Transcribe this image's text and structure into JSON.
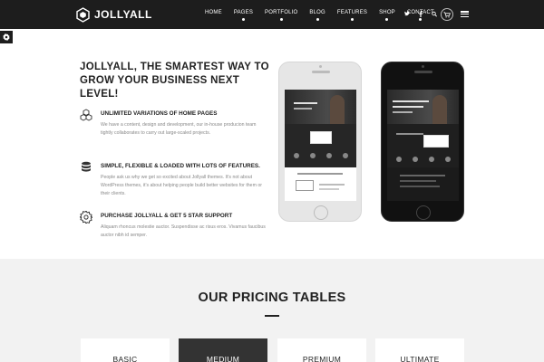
{
  "header": {
    "logo_text": "JOLLYALL",
    "logo_icon": "hexagon-icon",
    "nav": [
      "HOME",
      "PAGES",
      "PORTFOLIO",
      "BLOG",
      "FEATURES",
      "SHOP",
      "CONTACT"
    ],
    "social_icons": [
      "twitter-icon",
      "facebook-icon",
      "search-icon"
    ],
    "cart_icon": "cart-icon",
    "menu_icon": "hamburger-menu-icon"
  },
  "settings_icon": "gear-icon",
  "hero": {
    "title": "JOLLYALL, THE SMARTEST WAY TO GROW YOUR BUSINESS NEXT LEVEL!",
    "features": [
      {
        "icon": "cubes-icon",
        "title": "UNLIMITED VARIATIONS OF HOME PAGES",
        "text": "We have a content, design and development, our in-house producion team tightly collaborates to carry out large-scaled projects."
      },
      {
        "icon": "database-icon",
        "title": "SIMPLE, FLEXIBLE & LOADED WITH LOTS OF FEATURES.",
        "text": "People ask us why we get so excited about Jollyall themes. It's not about WordPress themes, it's about helping people build better websites for them or their clients."
      },
      {
        "icon": "gear-icon",
        "title": "PURCHASE JOLLYALL & GET 5 STAR SUPPORT",
        "text": "Aliquam rhoncus molestie auctor. Suspendisse ac risus eros. Vivamus faucibus auctor nibh id semper."
      }
    ]
  },
  "pricing": {
    "title": "OUR PRICING TABLES",
    "plans": [
      "BASIC",
      "MEDIUM",
      "PREMIUM",
      "ULTIMATE"
    ]
  },
  "colors": {
    "header_bg": "#1d1d1d",
    "pricing_bg": "#f2f2f2",
    "highlight_plan": "#333333"
  }
}
